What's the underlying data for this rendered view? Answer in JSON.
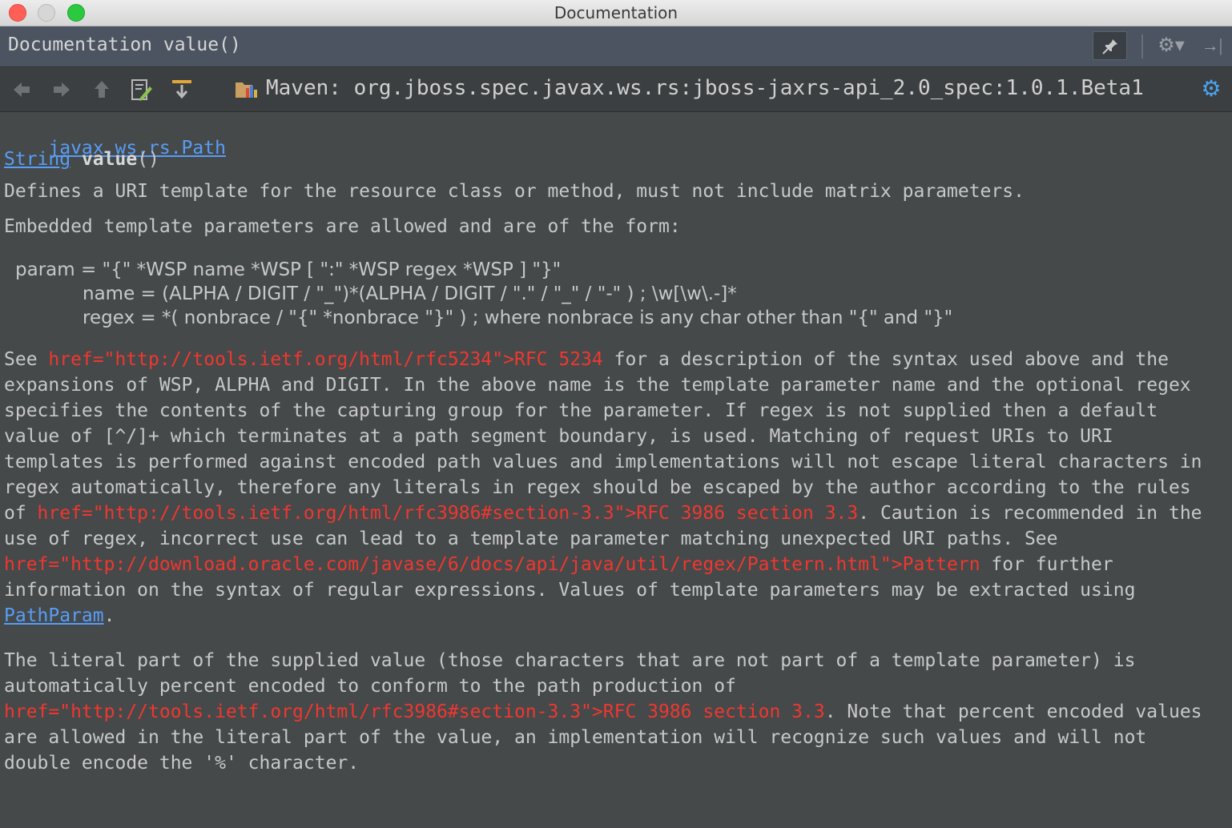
{
  "window": {
    "title": "Documentation"
  },
  "header": {
    "title": "Documentation value()",
    "icons": [
      "pin-icon",
      "gear-icon",
      "hide-panel-icon"
    ]
  },
  "toolbar": {
    "icons": [
      "back-arrow-icon",
      "forward-arrow-icon",
      "up-arrow-icon",
      "edit-source-icon",
      "external-doc-icon",
      "maven-library-icon",
      "settings-icon"
    ],
    "library_label": "Maven: org.jboss.spec.javax.ws.rs:jboss-jaxrs-api_2.0_spec:1.0.1.Beta1"
  },
  "doc": {
    "class_link": "javax.ws.rs.Path",
    "return_type": "String",
    "method_name": "value",
    "method_parens": "()",
    "summary": "Defines a URI template for the resource class or method, must not include matrix parameters.",
    "embedded_intro": "Embedded template parameters are allowed and are of the form:",
    "grammar": [
      "param = \"{\" *WSP name *WSP [ \":\" *WSP regex *WSP ] \"}\"",
      "name = (ALPHA / DIGIT / \"_\")*(ALPHA / DIGIT / \".\" / \"_\" / \"-\" ) ; \\w[\\w\\.-]*",
      "regex = *( nonbrace / \"{\" *nonbrace \"}\" ) ; where nonbrace is any char other than \"{\" and \"}\""
    ],
    "p1": {
      "l1_a": "See ",
      "l1_href": "href=\"http://tools.ietf.org/html/rfc5234\">RFC 5234",
      "l1_b": " for a description of the syntax used above and the",
      "l2": "expansions of WSP, ALPHA and DIGIT. In the above name is the template parameter name and the optional regex",
      "l3": "specifies the contents of the capturing group for the parameter. If regex is not supplied then a default",
      "l4": "value of [^/]+ which terminates at a path segment boundary, is used. Matching of request URIs to URI",
      "l5": "templates is performed against encoded path values and implementations will not escape literal characters in",
      "l6": "regex automatically, therefore any literals in regex should be escaped by the author according to the rules",
      "l7_a": "of ",
      "l7_href": "href=\"http://tools.ietf.org/html/rfc3986#section-3.3\">RFC 3986 section 3.3",
      "l7_b": ". Caution is recommended in the",
      "l8": "use of regex, incorrect use can lead to a template parameter matching unexpected URI paths. See",
      "l9_href": "href=\"http://download.oracle.com/javase/6/docs/api/java/util/regex/Pattern.html\">Pattern",
      "l9_b": " for further",
      "l10": "information on the syntax of regular expressions. Values of template parameters may be extracted using",
      "l11_link": "PathParam",
      "l11_b": "."
    },
    "p2": {
      "l1": "The literal part of the supplied value (those characters that are not part of a template parameter) is",
      "l2": "automatically percent encoded to conform to the path production of",
      "l3_href": "href=\"http://tools.ietf.org/html/rfc3986#section-3.3\">RFC 3986 section 3.3",
      "l3_b": ". Note that percent encoded values",
      "l4": "are allowed in the literal part of the value, an implementation will recognize such values and will not",
      "l5": "double encode the '%' character."
    }
  },
  "colors": {
    "background": "#45494a",
    "link": "#589df6",
    "raw_href": "#f0372f",
    "text": "#c8c8c8",
    "header_bg": "#4b5460",
    "toolbar_bg": "#3c3f41"
  }
}
